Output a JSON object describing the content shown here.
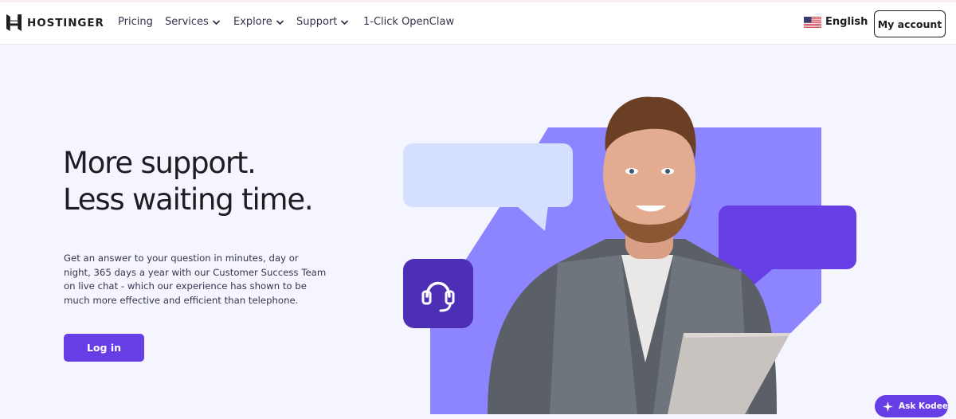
{
  "header": {
    "brand": "HOSTINGER",
    "nav": [
      {
        "label": "Pricing",
        "has_dropdown": false
      },
      {
        "label": "Services",
        "has_dropdown": true
      },
      {
        "label": "Explore",
        "has_dropdown": true
      },
      {
        "label": "Support",
        "has_dropdown": true
      },
      {
        "label": "1-Click OpenClaw",
        "has_dropdown": false
      }
    ],
    "language": "English",
    "account_label": "My account"
  },
  "hero": {
    "title_line1": "More support.",
    "title_line2": "Less waiting time.",
    "description": "Get an answer to your question in minutes, day or night, 365 days a year with our Customer Success Team on live chat - which our experience has shown to be much more effective and efficient than telephone.",
    "login_label": "Log in"
  },
  "illustration": {
    "icons": [
      "headset-icon",
      "chat-bubble-icon"
    ],
    "colors": {
      "accent": "#673de6",
      "lavender": "#8c85ff",
      "light_bubble": "#d5dfff",
      "dark_tile": "#4c2fb5"
    }
  },
  "chat_widget": {
    "label": "Ask Kodee"
  }
}
